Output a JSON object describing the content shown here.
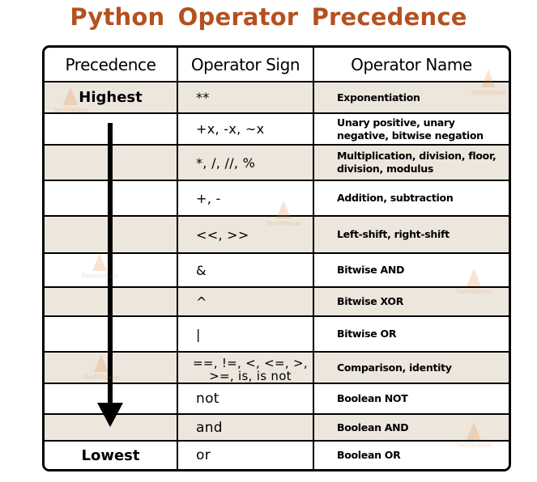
{
  "title": "Python Operator Precedence",
  "colors": {
    "title": "#B5501F",
    "shaded_row": "#EDE6DC",
    "border": "#000000"
  },
  "watermark": "TechVidvan",
  "table": {
    "headers": [
      "Precedence",
      "Operator Sign",
      "Operator Name"
    ],
    "rows": [
      {
        "precedence": "Highest",
        "sign": "**",
        "name": "Exponentiation"
      },
      {
        "precedence": "",
        "sign": "+x, -x, ~x",
        "name": "Unary positive, unary negative, bitwise negation"
      },
      {
        "precedence": "",
        "sign": "*, /, //, %",
        "name": "Multiplication, division, floor, division, modulus"
      },
      {
        "precedence": "",
        "sign": "+, -",
        "name": "Addition, subtraction"
      },
      {
        "precedence": "",
        "sign": "<<, >>",
        "name": "Left-shift, right-shift"
      },
      {
        "precedence": "",
        "sign": "&",
        "name": "Bitwise AND"
      },
      {
        "precedence": "",
        "sign": "^",
        "name": "Bitwise XOR"
      },
      {
        "precedence": "",
        "sign": "|",
        "name": "Bitwise OR"
      },
      {
        "precedence": "",
        "sign": "==, !=, <, <=, >, >=, is, is not",
        "name": "Comparison, identity"
      },
      {
        "precedence": "",
        "sign": "not",
        "name": "Boolean NOT"
      },
      {
        "precedence": "",
        "sign": "and",
        "name": "Boolean AND"
      },
      {
        "precedence": "Lowest",
        "sign": "or",
        "name": "Boolean OR"
      }
    ]
  },
  "arrow_direction": "down",
  "arrow_meaning": "decreasing precedence"
}
